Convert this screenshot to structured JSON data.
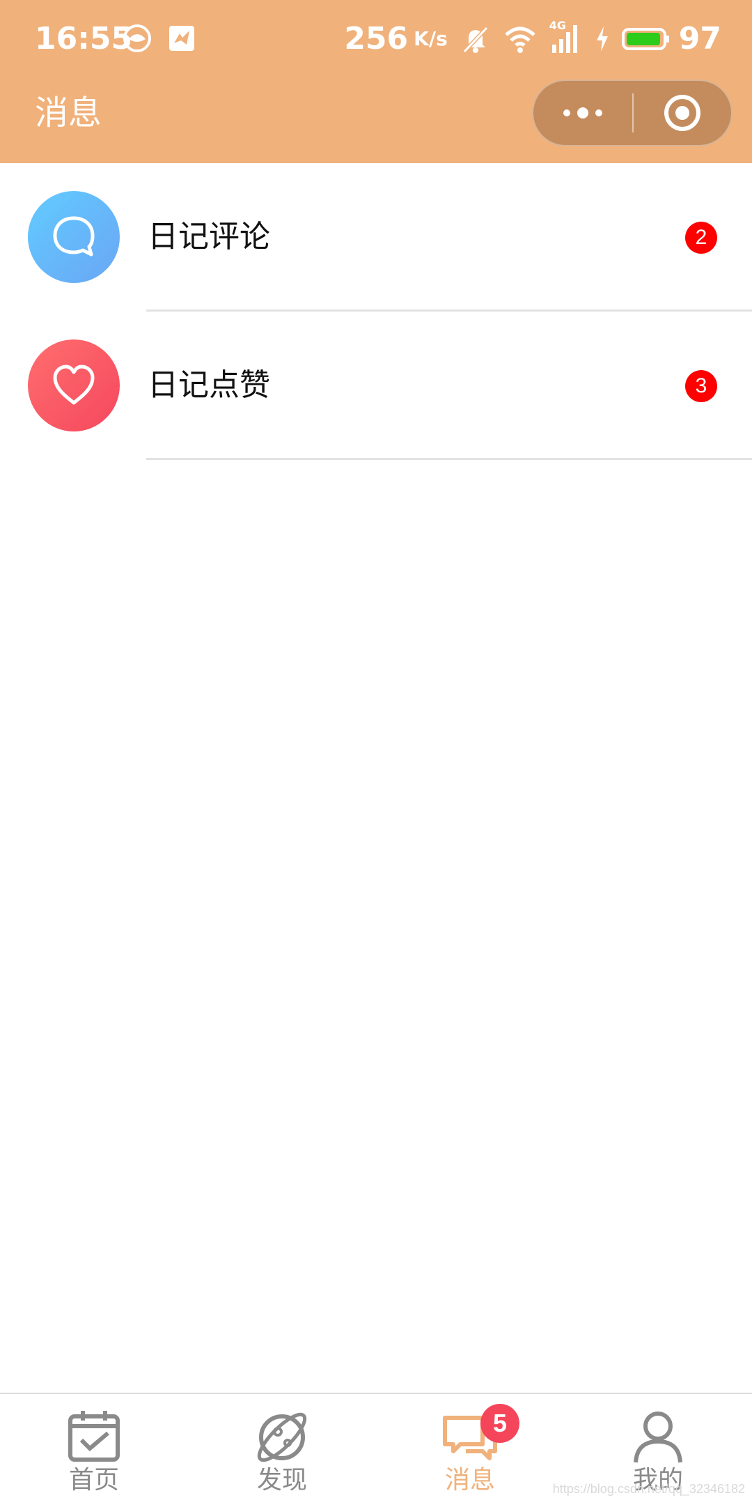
{
  "status_bar": {
    "time": "16:55",
    "net_speed": "256",
    "net_speed_unit": "K/s",
    "network": "4G",
    "battery_level": "97",
    "battery_fraction": 0.97
  },
  "header": {
    "title": "消息",
    "background_color": "#f0b17b"
  },
  "messages": [
    {
      "label": "日记评论",
      "badge": "2",
      "icon": "comment-bubble-icon"
    },
    {
      "label": "日记点赞",
      "badge": "3",
      "icon": "heart-icon"
    }
  ],
  "tabbar": {
    "active_color": "#f0b17b",
    "items": [
      {
        "label": "首页",
        "icon": "calendar-check-icon"
      },
      {
        "label": "发现",
        "icon": "planet-icon"
      },
      {
        "label": "消息",
        "icon": "chat-bubbles-icon",
        "badge": "5"
      },
      {
        "label": "我的",
        "icon": "person-icon"
      }
    ]
  },
  "watermark": "https://blog.csdn.net/qq_32346182"
}
